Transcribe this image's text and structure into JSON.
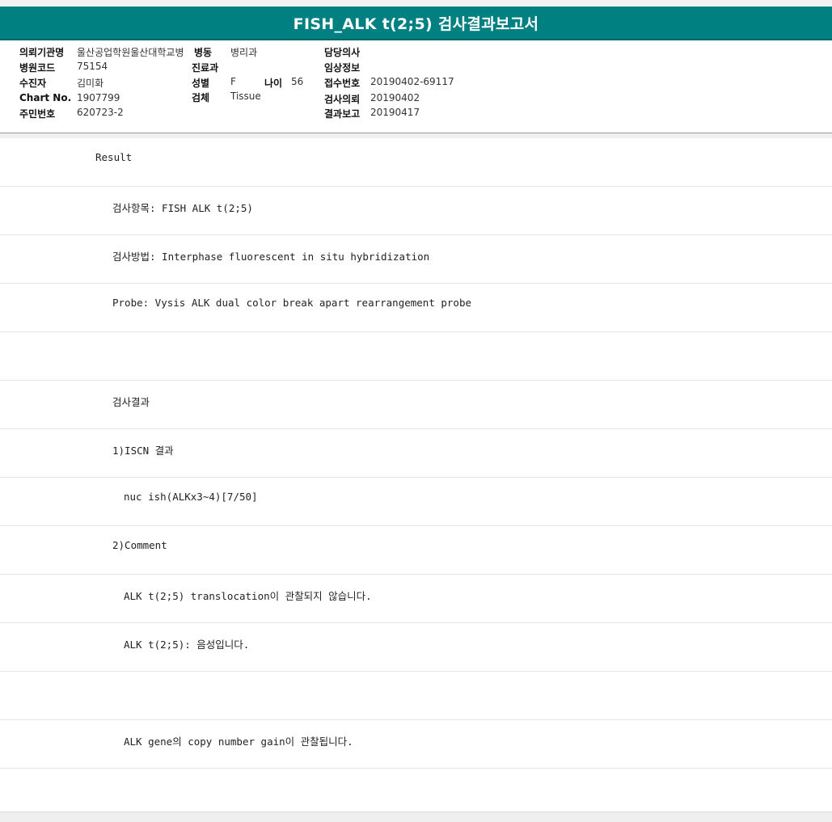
{
  "report": {
    "title": "FISH_ALK t(2;5) 검사결과보고서"
  },
  "header": {
    "requesting_institution_label": "의뢰기관명",
    "requesting_institution": "울산공업학원울산대학교병",
    "ward_label": "병동",
    "ward": "병리과",
    "attending_label": "담당의사",
    "attending": "",
    "hospital_code_label": "병원코드",
    "hospital_code": "75154",
    "department_label": "진료과",
    "department": "",
    "clinical_info_label": "임상정보",
    "clinical_info": "",
    "examinee_label": "수진자",
    "examinee": "김미화",
    "sex_label": "성별",
    "sex": "F",
    "age_label": "나이",
    "age": "56",
    "receipt_no_label": "접수번호",
    "receipt_no": "20190402-69117",
    "chart_no_label": "Chart No.",
    "chart_no": "1907799",
    "specimen_label": "검체",
    "specimen": "Tissue",
    "request_date_label": "검사의뢰",
    "request_date": "20190402",
    "ssn_label": "주민번호",
    "ssn": "620723-2",
    "report_date_label": "결과보고",
    "report_date": "20190417"
  },
  "lines": [
    {
      "text": "Result",
      "indent": 0
    },
    {
      "text": "검사항목: FISH ALK t(2;5)",
      "indent": 1
    },
    {
      "text": "검사방법: Interphase fluorescent in situ hybridization",
      "indent": 1
    },
    {
      "text": "Probe: Vysis ALK dual color break apart rearrangement probe",
      "indent": 1
    },
    {
      "text": "",
      "indent": 1
    },
    {
      "text": "검사결과",
      "indent": 1
    },
    {
      "text": "1)ISCN 결과",
      "indent": 1
    },
    {
      "text": "nuc ish(ALKx3~4)[7/50]",
      "indent": 2
    },
    {
      "text": "2)Comment",
      "indent": 1
    },
    {
      "text": "ALK t(2;5) translocation이 관찰되지 않습니다.",
      "indent": 2
    },
    {
      "text": "ALK t(2;5): 음성입니다.",
      "indent": 2
    },
    {
      "text": "",
      "indent": 2
    },
    {
      "text": "ALK gene의 copy number gain이 관찰됩니다.",
      "indent": 2
    },
    {
      "text": "",
      "indent": 2
    }
  ]
}
